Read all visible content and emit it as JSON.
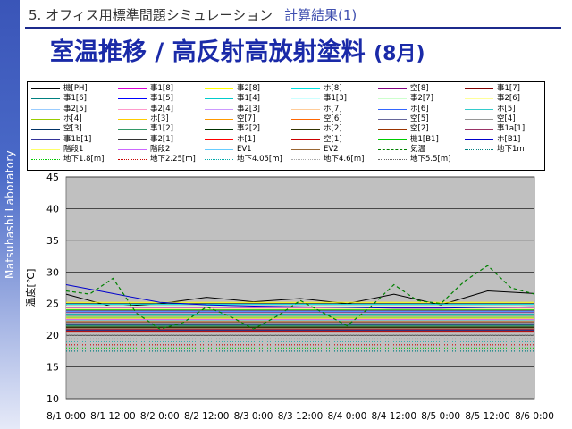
{
  "sidebar": {
    "label": "Matsuhashi Laboratory"
  },
  "header": {
    "number": "5.",
    "section": "オフィス用標準問題シミュレーション",
    "subtitle": "計算結果(1)"
  },
  "title": {
    "main": "室温推移 / 高反射高放射塗料",
    "month": "(8月)"
  },
  "chart_data": {
    "type": "line",
    "title": "",
    "xlabel": "",
    "ylabel": "温度[℃]",
    "ylim": [
      10,
      45
    ],
    "yticks": [
      "10",
      "15",
      "20",
      "25",
      "30",
      "35",
      "40",
      "45"
    ],
    "xticks": [
      "8/1 0:00",
      "8/1 12:00",
      "8/2 0:00",
      "8/2 12:00",
      "8/3 0:00",
      "8/3 12:00",
      "8/4 0:00",
      "8/4 12:00",
      "8/5 0:00",
      "8/5 12:00",
      "8/6 0:00"
    ],
    "xrange_hours": [
      0,
      120
    ],
    "grid": "horizontal",
    "legend_position": "top",
    "plot_background": "#c0c0c0",
    "series": [
      {
        "name": "機[PH]",
        "color": "#000000",
        "dash": "solid",
        "x": [
          0,
          12,
          24,
          36,
          48,
          60,
          72,
          84,
          96,
          108,
          120
        ],
        "y": [
          26.5,
          24.5,
          25.0,
          26.0,
          25.3,
          25.8,
          25.0,
          26.5,
          24.8,
          27.0,
          26.6
        ]
      },
      {
        "name": "事1[8]",
        "color": "#d400d4",
        "dash": "solid",
        "x": [
          0,
          120
        ],
        "y": [
          24.4,
          24.4
        ]
      },
      {
        "name": "事2[8]",
        "color": "#ffff00",
        "dash": "solid",
        "x": [
          0,
          120
        ],
        "y": [
          25.2,
          25.2
        ]
      },
      {
        "name": "ホ[8]",
        "color": "#00e0e0",
        "dash": "solid",
        "x": [
          0,
          120
        ],
        "y": [
          24.9,
          24.9
        ]
      },
      {
        "name": "空[8]",
        "color": "#800080",
        "dash": "solid",
        "x": [
          0,
          120
        ],
        "y": [
          23.9,
          23.9
        ]
      },
      {
        "name": "事1[7]",
        "color": "#800000",
        "dash": "solid",
        "x": [
          0,
          120
        ],
        "y": [
          23.6,
          23.6
        ]
      },
      {
        "name": "事1[6]",
        "color": "#008080",
        "dash": "solid",
        "x": [
          0,
          120
        ],
        "y": [
          23.3,
          23.3
        ]
      },
      {
        "name": "事1[5]",
        "color": "#0000ff",
        "dash": "solid",
        "x": [
          0,
          120
        ],
        "y": [
          23.1,
          23.1
        ]
      },
      {
        "name": "事1[4]",
        "color": "#00cccc",
        "dash": "solid",
        "x": [
          0,
          120
        ],
        "y": [
          22.9,
          22.9
        ]
      },
      {
        "name": "事1[3]",
        "color": "#ccffff",
        "dash": "solid",
        "x": [
          0,
          120
        ],
        "y": [
          22.7,
          22.7
        ]
      },
      {
        "name": "事2[7]",
        "color": "#ccffcc",
        "dash": "solid",
        "x": [
          0,
          120
        ],
        "y": [
          24.6,
          24.6
        ]
      },
      {
        "name": "事2[6]",
        "color": "#ffff99",
        "dash": "solid",
        "x": [
          0,
          120
        ],
        "y": [
          24.2,
          24.2
        ]
      },
      {
        "name": "事2[5]",
        "color": "#99ccff",
        "dash": "solid",
        "x": [
          0,
          120
        ],
        "y": [
          23.8,
          23.8
        ]
      },
      {
        "name": "事2[4]",
        "color": "#ff99cc",
        "dash": "solid",
        "x": [
          0,
          120
        ],
        "y": [
          23.5,
          23.5
        ]
      },
      {
        "name": "事2[3]",
        "color": "#cc99ff",
        "dash": "solid",
        "x": [
          0,
          120
        ],
        "y": [
          23.2,
          23.2
        ]
      },
      {
        "name": "ホ[7]",
        "color": "#ffcc99",
        "dash": "solid",
        "x": [
          0,
          120
        ],
        "y": [
          24.1,
          24.1
        ]
      },
      {
        "name": "ホ[6]",
        "color": "#3366ff",
        "dash": "solid",
        "x": [
          0,
          120
        ],
        "y": [
          23.7,
          23.7
        ]
      },
      {
        "name": "ホ[5]",
        "color": "#33cccc",
        "dash": "solid",
        "x": [
          0,
          120
        ],
        "y": [
          23.4,
          23.4
        ]
      },
      {
        "name": "ホ[4]",
        "color": "#99cc00",
        "dash": "solid",
        "x": [
          0,
          120
        ],
        "y": [
          22.8,
          22.8
        ]
      },
      {
        "name": "ホ[3]",
        "color": "#ffcc00",
        "dash": "solid",
        "x": [
          0,
          120
        ],
        "y": [
          22.6,
          22.6
        ]
      },
      {
        "name": "空[7]",
        "color": "#ff9900",
        "dash": "solid",
        "x": [
          0,
          120
        ],
        "y": [
          22.4,
          22.4
        ]
      },
      {
        "name": "空[6]",
        "color": "#ff6600",
        "dash": "solid",
        "x": [
          0,
          120
        ],
        "y": [
          22.2,
          22.2
        ]
      },
      {
        "name": "空[5]",
        "color": "#666699",
        "dash": "solid",
        "x": [
          0,
          120
        ],
        "y": [
          22.0,
          22.0
        ]
      },
      {
        "name": "空[4]",
        "color": "#969696",
        "dash": "solid",
        "x": [
          0,
          120
        ],
        "y": [
          21.8,
          21.8
        ]
      },
      {
        "name": "空[3]",
        "color": "#003366",
        "dash": "solid",
        "x": [
          0,
          120
        ],
        "y": [
          21.6,
          21.6
        ]
      },
      {
        "name": "事1[2]",
        "color": "#339966",
        "dash": "solid",
        "x": [
          0,
          120
        ],
        "y": [
          21.5,
          21.5
        ]
      },
      {
        "name": "事2[2]",
        "color": "#003300",
        "dash": "solid",
        "x": [
          0,
          120
        ],
        "y": [
          21.3,
          21.3
        ]
      },
      {
        "name": "ホ[2]",
        "color": "#333300",
        "dash": "solid",
        "x": [
          0,
          120
        ],
        "y": [
          21.2,
          21.2
        ]
      },
      {
        "name": "空[2]",
        "color": "#993300",
        "dash": "solid",
        "x": [
          0,
          120
        ],
        "y": [
          21.0,
          21.0
        ]
      },
      {
        "name": "事1a[1]",
        "color": "#993366",
        "dash": "solid",
        "x": [
          0,
          120
        ],
        "y": [
          20.9,
          20.9
        ]
      },
      {
        "name": "事1b[1]",
        "color": "#333399",
        "dash": "solid",
        "x": [
          0,
          120
        ],
        "y": [
          20.8,
          20.8
        ]
      },
      {
        "name": "事2[1]",
        "color": "#333333",
        "dash": "solid",
        "x": [
          0,
          120
        ],
        "y": [
          20.7,
          20.7
        ]
      },
      {
        "name": "ホ[1]",
        "color": "#ff0000",
        "dash": "solid",
        "x": [
          0,
          120
        ],
        "y": [
          20.6,
          20.6
        ]
      },
      {
        "name": "空[1]",
        "color": "#cc0000",
        "dash": "solid",
        "x": [
          0,
          120
        ],
        "y": [
          20.5,
          20.5
        ]
      },
      {
        "name": "機1[B1]",
        "color": "#00cc00",
        "dash": "solid",
        "x": [
          0,
          120
        ],
        "y": [
          24.0,
          24.0
        ]
      },
      {
        "name": "ホ[B1]",
        "color": "#0000cc",
        "dash": "solid",
        "x": [
          0,
          12,
          24,
          36,
          48,
          60,
          72,
          84,
          96,
          108,
          120
        ],
        "y": [
          28.0,
          26.6,
          25.2,
          24.8,
          24.6,
          24.5,
          24.4,
          24.3,
          24.3,
          24.4,
          24.5
        ]
      },
      {
        "name": "階段1",
        "color": "#ffff66",
        "dash": "solid",
        "x": [
          0,
          120
        ],
        "y": [
          23.0,
          23.0
        ]
      },
      {
        "name": "階段2",
        "color": "#cc66ff",
        "dash": "solid",
        "x": [
          0,
          120
        ],
        "y": [
          22.5,
          22.5
        ]
      },
      {
        "name": "EV1",
        "color": "#66ccff",
        "dash": "solid",
        "x": [
          0,
          120
        ],
        "y": [
          22.3,
          22.3
        ]
      },
      {
        "name": "EV2",
        "color": "#996633",
        "dash": "solid",
        "x": [
          0,
          120
        ],
        "y": [
          22.1,
          22.1
        ]
      },
      {
        "name": "気温",
        "color": "#008000",
        "dash": "dash",
        "x": [
          0,
          6,
          12,
          18,
          24,
          30,
          36,
          42,
          48,
          54,
          60,
          66,
          72,
          78,
          84,
          90,
          96,
          102,
          108,
          114,
          120
        ],
        "y": [
          27.0,
          26.5,
          29.0,
          23.5,
          21.0,
          22.0,
          24.5,
          23.0,
          21.0,
          23.0,
          25.5,
          23.5,
          21.5,
          24.5,
          28.0,
          25.5,
          25.0,
          28.5,
          31.0,
          27.5,
          26.5
        ]
      },
      {
        "name": "地下1m",
        "color": "#008080",
        "dash": "dot",
        "x": [
          0,
          120
        ],
        "y": [
          17.5,
          17.5
        ]
      },
      {
        "name": "地下1.8[m]",
        "color": "#00cc00",
        "dash": "dot",
        "x": [
          0,
          120
        ],
        "y": [
          18.0,
          18.0
        ]
      },
      {
        "name": "地下2.25[m]",
        "color": "#cc0000",
        "dash": "dot",
        "x": [
          0,
          120
        ],
        "y": [
          18.5,
          18.5
        ]
      },
      {
        "name": "地下4.05[m]",
        "color": "#00aaaa",
        "dash": "dot",
        "x": [
          0,
          120
        ],
        "y": [
          19.0,
          19.0
        ]
      },
      {
        "name": "地下4.6[m]",
        "color": "#aaaaaa",
        "dash": "dot",
        "x": [
          0,
          120
        ],
        "y": [
          19.5,
          19.5
        ]
      },
      {
        "name": "地下5.5[m]",
        "color": "#666666",
        "dash": "dot",
        "x": [
          0,
          120
        ],
        "y": [
          20.0,
          20.0
        ]
      }
    ]
  }
}
